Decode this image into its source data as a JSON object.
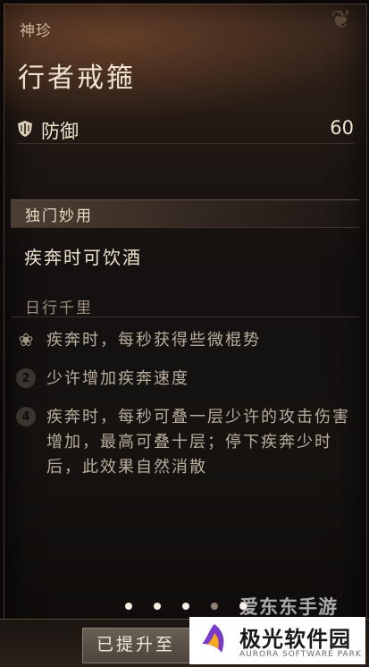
{
  "header": {
    "category": "神珍",
    "title": "行者戒箍"
  },
  "stat": {
    "label": "防御",
    "value": "60",
    "icon": "shield-icon"
  },
  "unique_use": {
    "title": "独门妙用",
    "description": "疾奔时可饮酒"
  },
  "set_bonus": {
    "title": "日行千里",
    "effects": [
      {
        "icon": "lotus-icon",
        "marker": "",
        "text": "疾奔时，每秒获得些微棍势"
      },
      {
        "icon": "tier-badge-icon",
        "marker": "2",
        "text": "少许增加疾奔速度"
      },
      {
        "icon": "tier-badge-icon",
        "marker": "4",
        "text": "疾奔时，每秒可叠一层少许的攻击伤害增加，最高可叠十层；停下疾奔少时后，此效果自然消散"
      }
    ]
  },
  "pager": {
    "active_index": 3,
    "count": 5
  },
  "footer": {
    "button_text": "已提升至"
  },
  "watermark": {
    "overlay_text": "爱东东手游",
    "logo_cn": "极光软件园",
    "logo_en": "AURORA SOFTWARE PARK"
  }
}
